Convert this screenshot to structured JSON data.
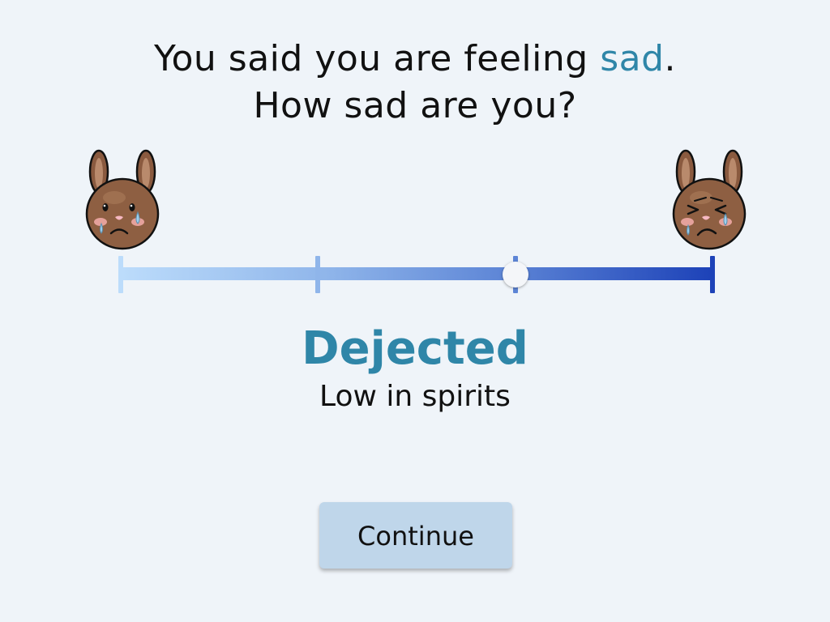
{
  "prompt": {
    "line1_prefix": "You said you are feeling ",
    "emotion": "sad",
    "line1_suffix": ".",
    "line2": "How sad are you?"
  },
  "scale": {
    "left_icon": "crying-bunny-icon",
    "right_icon": "sobbing-bunny-icon",
    "stops": 4,
    "selected_index": 2,
    "colors": [
      "#bcdcfb",
      "#8fb5ea",
      "#5d85d6",
      "#1d42b8"
    ]
  },
  "selection": {
    "title": "Dejected",
    "description": "Low in spirits"
  },
  "continue_label": "Continue",
  "colors": {
    "background": "#eff4f9",
    "accent": "#2f86a8",
    "button": "#bfd6ea"
  }
}
